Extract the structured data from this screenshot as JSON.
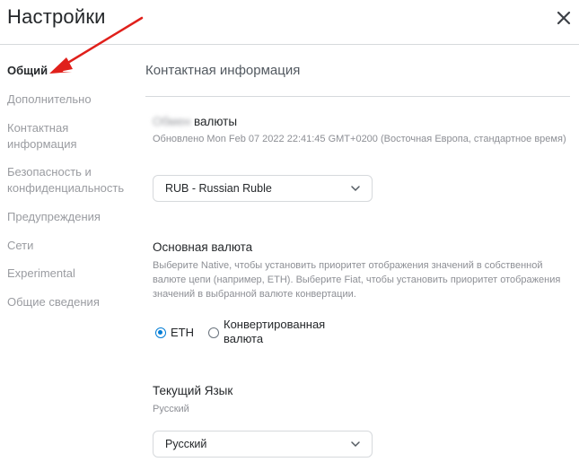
{
  "header": {
    "title": "Настройки",
    "close_icon": "close-icon"
  },
  "sidebar": {
    "items": [
      {
        "label": "Общий",
        "active": true
      },
      {
        "label": "Дополнительно",
        "active": false
      },
      {
        "label": "Контактная информация",
        "active": false
      },
      {
        "label": "Безопасность и конфиденциальность",
        "active": false
      },
      {
        "label": "Предупреждения",
        "active": false
      },
      {
        "label": "Сети",
        "active": false
      },
      {
        "label": "Experimental",
        "active": false
      },
      {
        "label": "Общие сведения",
        "active": false
      }
    ]
  },
  "main": {
    "section_title": "Контактная информация",
    "conversion": {
      "label_blurred": "Обмен",
      "label": "валюты",
      "updated": "Обновлено Mon Feb 07 2022 22:41:45 GMT+0200 (Восточная Европа, стандартное время)",
      "selected": "RUB - Russian Ruble"
    },
    "primary_currency": {
      "label": "Основная валюта",
      "description": "Выберите Native, чтобы установить приоритет отображения значений в собственной валюте цепи (например, ETH). Выберите Fiat, чтобы установить приоритет отображения значений в выбранной валюте конвертации.",
      "options": [
        {
          "label": "ETH",
          "selected": true
        },
        {
          "label": "Конвертированная валюта",
          "selected": false
        }
      ]
    },
    "language": {
      "label": "Текущий Язык",
      "current": "Русский",
      "selected": "Русский"
    }
  },
  "colors": {
    "accent": "#037dd6",
    "annotation_arrow": "#e0201b",
    "muted_text": "#9a9ca1"
  }
}
